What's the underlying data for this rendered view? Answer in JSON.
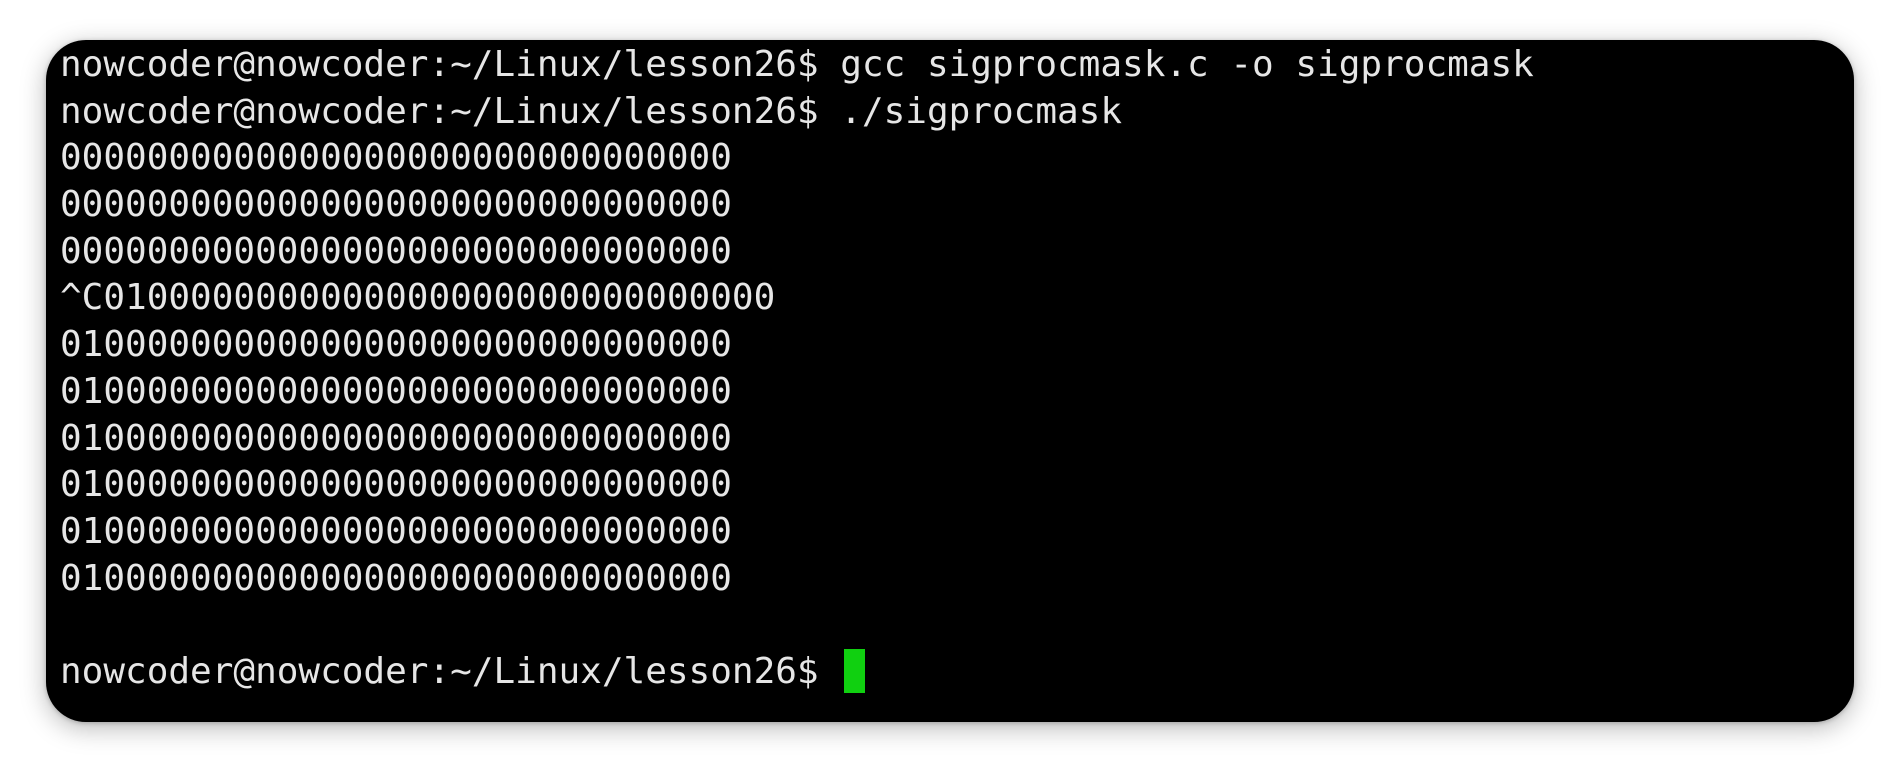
{
  "terminal": {
    "lines": [
      "nowcoder@nowcoder:~/Linux/lesson26$ gcc sigprocmask.c -o sigprocmask",
      "nowcoder@nowcoder:~/Linux/lesson26$ ./sigprocmask",
      "0000000000000000000000000000000",
      "0000000000000000000000000000000",
      "0000000000000000000000000000000",
      "^C0100000000000000000000000000000",
      "0100000000000000000000000000000",
      "0100000000000000000000000000000",
      "0100000000000000000000000000000",
      "0100000000000000000000000000000",
      "0100000000000000000000000000000",
      "0100000000000000000000000000000",
      ""
    ],
    "prompt": "nowcoder@nowcoder:~/Linux/lesson26$ "
  },
  "colors": {
    "background": "#000000",
    "text": "#e6e6e6",
    "cursor": "#10d010"
  }
}
